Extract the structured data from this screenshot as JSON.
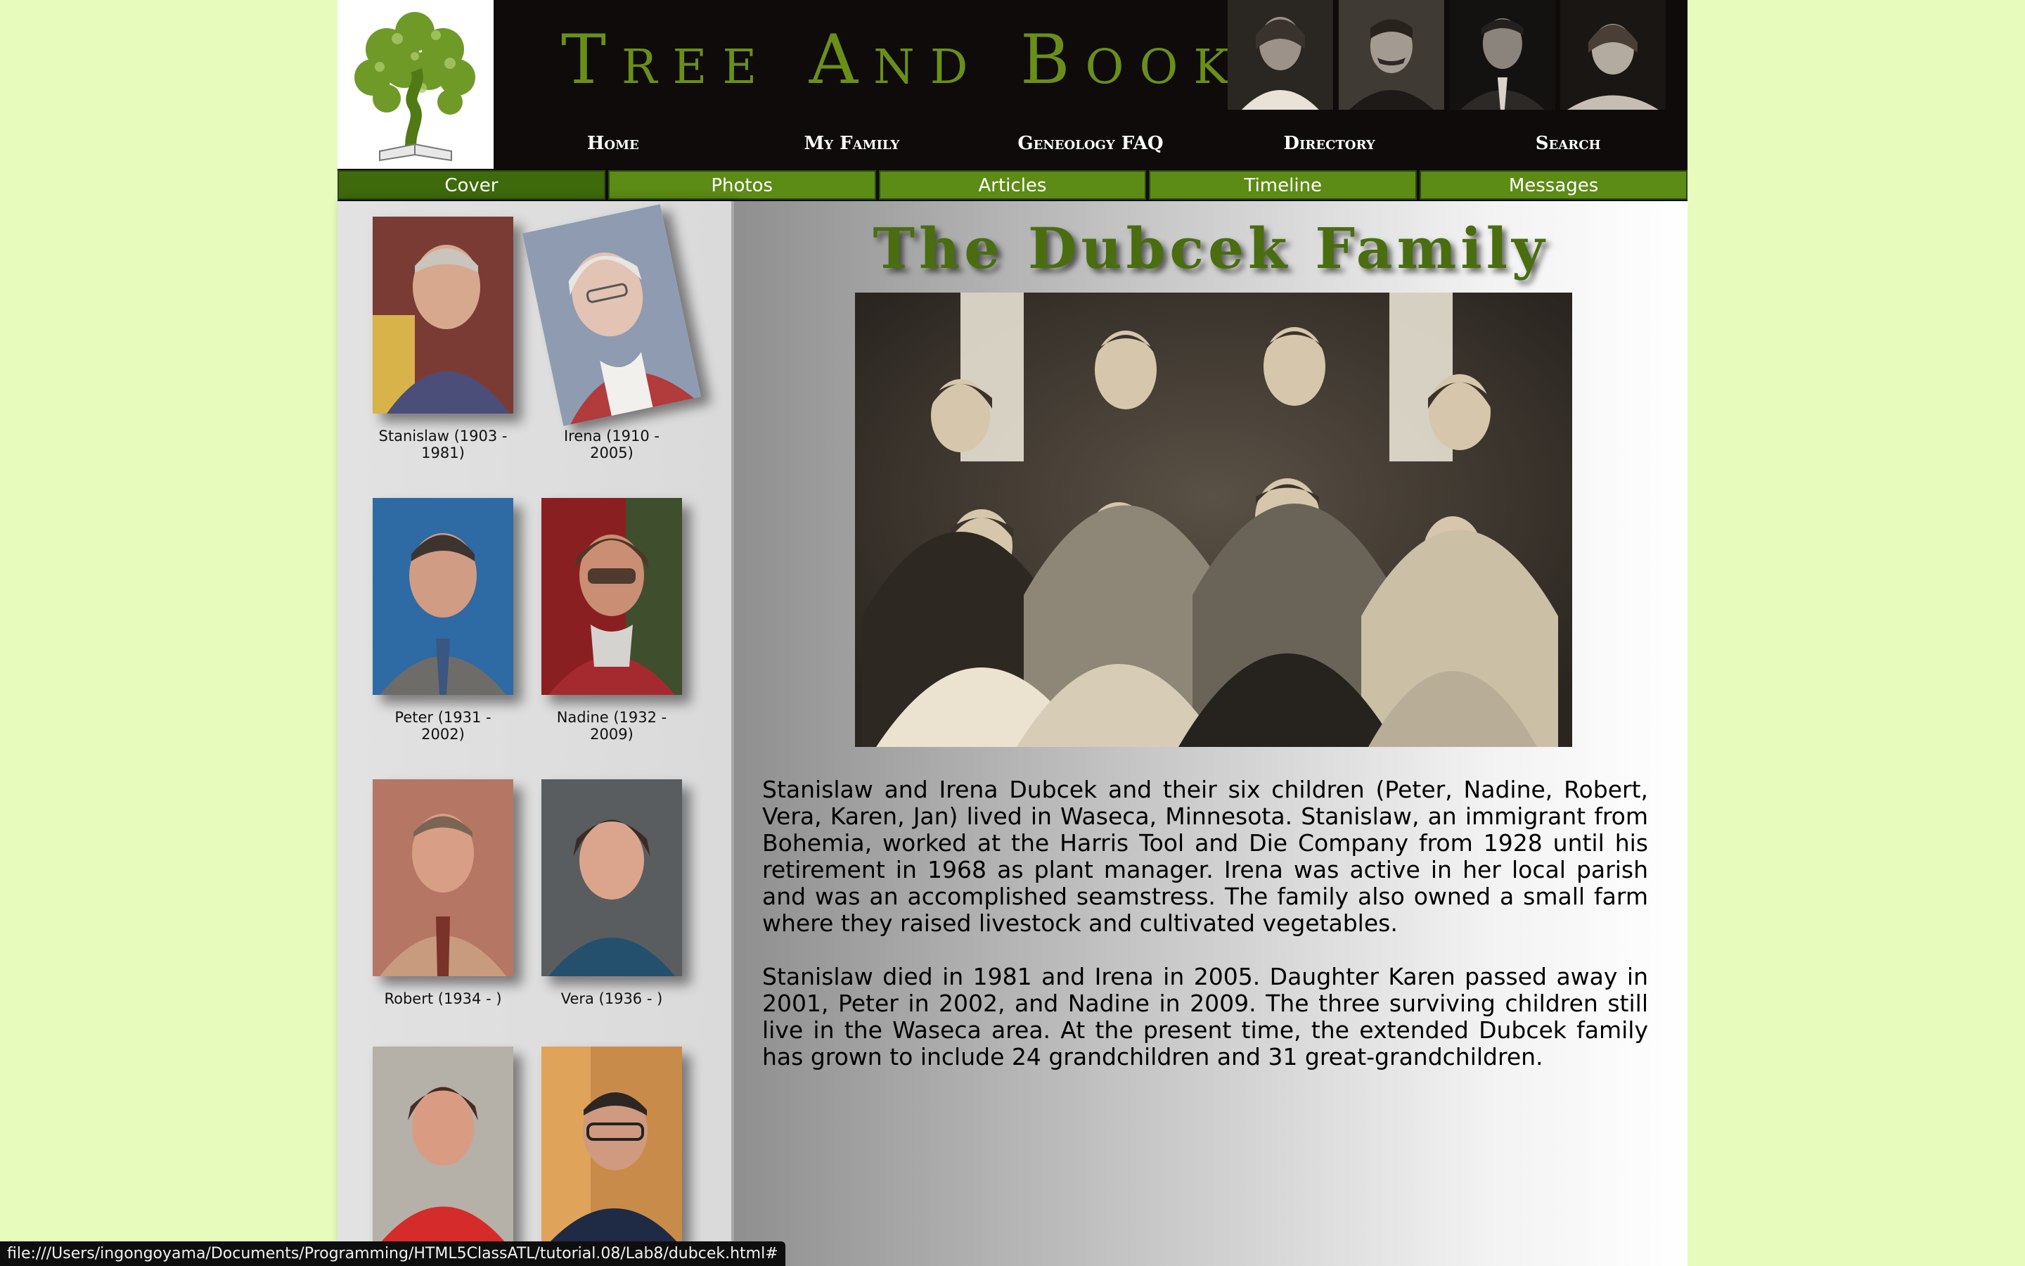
{
  "header": {
    "site_title": "Tree And Book",
    "nav": [
      "Home",
      "My Family",
      "Geneology FAQ",
      "Directory",
      "Search"
    ]
  },
  "tabs": [
    "Cover",
    "Photos",
    "Articles",
    "Timeline",
    "Messages"
  ],
  "sidebar": {
    "people": [
      {
        "caption": "Stanislaw (1903 - 1981)"
      },
      {
        "caption": "Irena (1910 - 2005)"
      },
      {
        "caption": "Peter (1931 - 2002)"
      },
      {
        "caption": "Nadine (1932 - 2009)"
      },
      {
        "caption": "Robert (1934 - )"
      },
      {
        "caption": "Vera (1936 - )"
      },
      {
        "caption": ""
      },
      {
        "caption": ""
      }
    ]
  },
  "main": {
    "title": "The Dubcek Family",
    "paragraphs": [
      "Stanislaw and Irena Dubcek and their six children (Peter, Nadine, Robert, Vera, Karen, Jan) lived in Waseca, Minnesota. Stanislaw, an immigrant from Bohemia, worked at the Harris Tool and Die Company from 1928 until his retirement in 1968 as plant manager. Irena was active in her local parish and was an accomplished seamstress. The family also owned a small farm where they raised livestock and cultivated vegetables.",
      "Stanislaw died in 1981 and Irena in 2005. Daughter Karen passed away in 2001, Peter in 2002, and Nadine in 2009. The three surviving children still live in the Waseca area. At the present time, the extended Dubcek family has grown to include 24 grandchildren and 31 great-grandchildren."
    ]
  },
  "statusbar": {
    "url": "file:///Users/ingongoyama/Documents/Programming/HTML5ClassATL/tutorial.08/Lab8/dubcek.html#"
  },
  "colors": {
    "background": "#e6fbbc",
    "header_bg": "#0f0b0a",
    "title_green": "#6a8f19",
    "tab_green": "#5c8b16"
  }
}
